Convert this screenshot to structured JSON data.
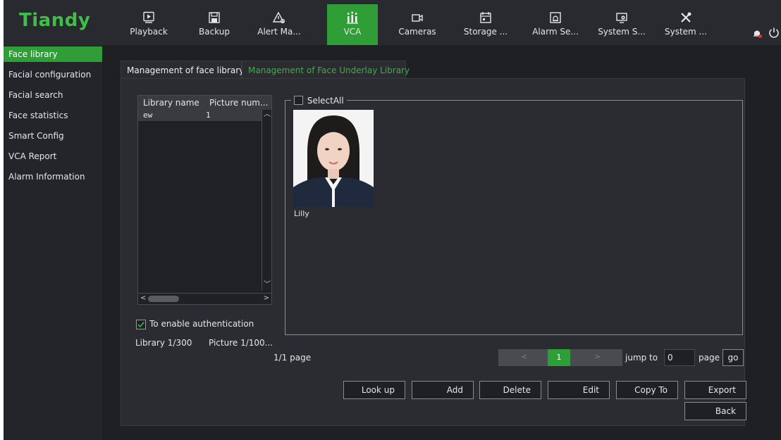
{
  "brand": {
    "logo_text": "Tiandy",
    "accent": "#2f9e37"
  },
  "nav": [
    {
      "label": "Playback",
      "icon": "playback-icon"
    },
    {
      "label": "Backup",
      "icon": "save-icon"
    },
    {
      "label": "Alert Ma...",
      "icon": "alert-icon"
    },
    {
      "label": "VCA",
      "icon": "vca-icon",
      "active": true
    },
    {
      "label": "Cameras",
      "icon": "camera-icon"
    },
    {
      "label": "Storage ...",
      "icon": "storage-icon"
    },
    {
      "label": "Alarm Se...",
      "icon": "alarm-icon"
    },
    {
      "label": "System S...",
      "icon": "system-settings-icon"
    },
    {
      "label": "System ...",
      "icon": "tools-icon"
    }
  ],
  "sidebar": {
    "items": [
      {
        "label": "Face library",
        "active": true
      },
      {
        "label": "Facial configuration"
      },
      {
        "label": "Facial search"
      },
      {
        "label": "Face statistics"
      },
      {
        "label": "Smart Config"
      },
      {
        "label": "VCA Report"
      },
      {
        "label": "Alarm Information"
      }
    ]
  },
  "tabs": [
    {
      "label": "Management of face library"
    },
    {
      "label": "Management of Face Underlay Library",
      "active": true
    }
  ],
  "library_table": {
    "columns": [
      "Library name",
      "Picture num..."
    ],
    "rows": [
      {
        "name": "ew",
        "count": "1"
      }
    ]
  },
  "auth": {
    "label": "To enable authentication",
    "checked": true
  },
  "counts": {
    "library": "Library 1/300",
    "picture": "Picture 1/100..."
  },
  "select_all": {
    "label": "SelectAll",
    "checked": false
  },
  "faces": [
    {
      "name": "Lilly"
    }
  ],
  "pagination": {
    "page_info": "1/1 page",
    "prev": "<",
    "current": "1",
    "next": ">",
    "jump_label": "jump to",
    "jump_value": "0",
    "page_label": "page",
    "go_label": "go"
  },
  "actions": {
    "look_up": "Look up",
    "add": "Add",
    "delete": "Delete",
    "edit": "Edit",
    "copy_to": "Copy To",
    "export": "Export",
    "back": "Back"
  }
}
